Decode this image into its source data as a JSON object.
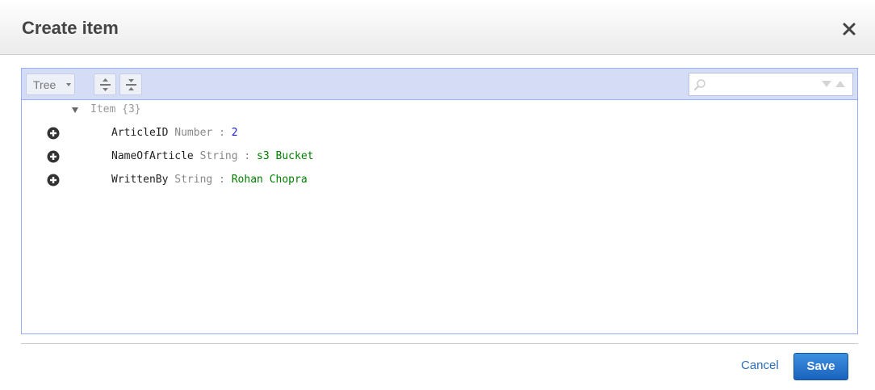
{
  "dialog": {
    "title": "Create item"
  },
  "toolbar": {
    "mode_label": "Tree",
    "search_value": ""
  },
  "tree": {
    "root": {
      "label": "Item",
      "count": "{3}"
    },
    "fields": [
      {
        "name": "ArticleID",
        "type": "Number",
        "value": "2",
        "value_kind": "number"
      },
      {
        "name": "NameOfArticle",
        "type": "String",
        "value": "s3 Bucket",
        "value_kind": "string"
      },
      {
        "name": "WrittenBy",
        "type": "String",
        "value": "Rohan Chopra",
        "value_kind": "string"
      }
    ]
  },
  "footer": {
    "cancel_label": "Cancel",
    "save_label": "Save"
  },
  "colors": {
    "save_button": "#1a63bd",
    "link": "#2a6ebb",
    "toolbar_bg": "#d5ddf6",
    "number_value": "#1a1ad6",
    "string_value": "#008000"
  },
  "icons": {
    "close": "close-icon",
    "expand_all": "expand-all-icon",
    "collapse_all": "collapse-all-icon",
    "search": "search-icon",
    "add": "plus-circle-icon"
  }
}
